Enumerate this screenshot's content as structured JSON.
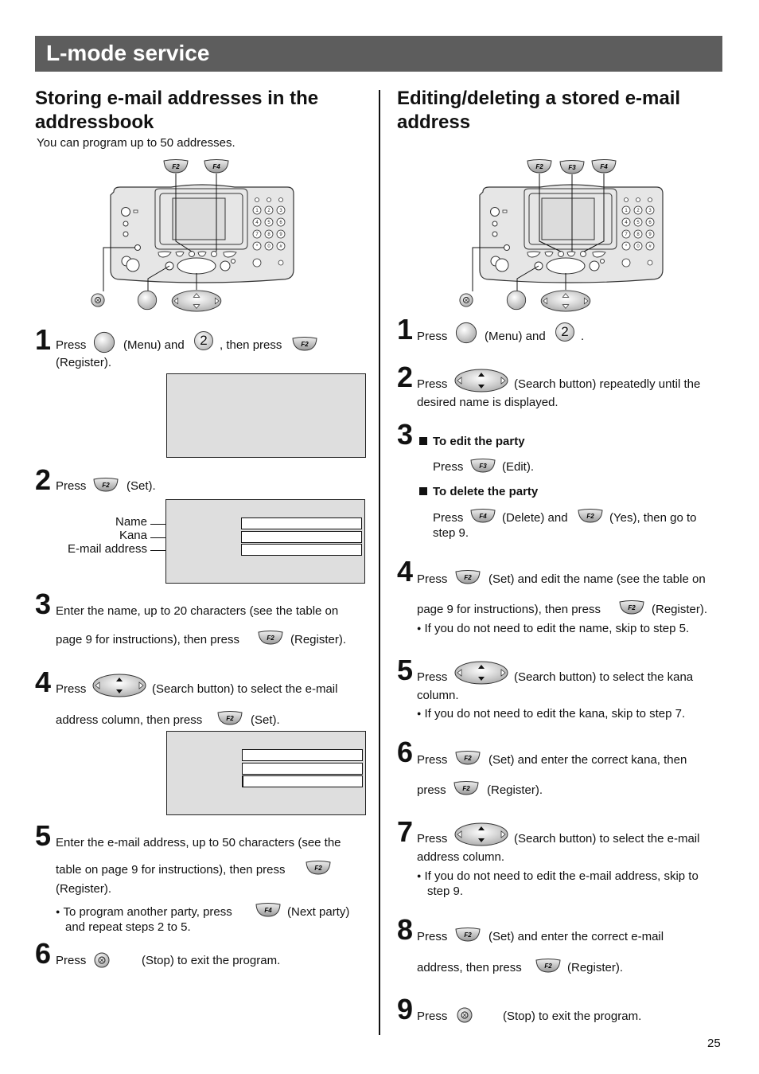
{
  "header": {
    "title": "L-mode service"
  },
  "left": {
    "title_line1": "Storing e-mail addresses in the",
    "title_line2": "addressbook",
    "intro": "You can program up to 50 addresses.",
    "diagram": {
      "softkeys": [
        "F2",
        "F4"
      ]
    },
    "steps": [
      {
        "num": "1",
        "parts": [
          "Press",
          "(Menu) and",
          ", then press",
          "(Register)."
        ],
        "key_2": "2"
      },
      {
        "num": "2",
        "parts": [
          "Press",
          "(Set)."
        ],
        "screen_labels": [
          "Name",
          "Kana",
          "E-mail address"
        ]
      },
      {
        "num": "3",
        "line1": "Enter the name, up to 20 characters (see the table on",
        "line2_a": "page 9 for instructions), then press",
        "line2_b": "(Register)."
      },
      {
        "num": "4",
        "line1_a": "Press",
        "line1_b": "(Search button) to select the e-mail",
        "line2_a": "address column, then press",
        "line2_b": "(Set)."
      },
      {
        "num": "5",
        "line1": "Enter the e-mail address, up to 50 characters (see the",
        "line2_a": "table on page 9 for instructions), then press",
        "line3": "(Register).",
        "bullet_a": "To program another party, press",
        "bullet_b": "(Next party)",
        "bullet_c": "and repeat steps 2 to 5."
      },
      {
        "num": "6",
        "a": "Press",
        "b": "(Stop) to exit the program."
      }
    ]
  },
  "right": {
    "title_line1": "Editing/deleting a stored e-mail",
    "title_line2": "address",
    "diagram": {
      "softkeys": [
        "F2",
        "F3",
        "F4"
      ]
    },
    "steps": [
      {
        "num": "1",
        "a": "Press",
        "b": "(Menu) and",
        "c": ".",
        "key_2": "2"
      },
      {
        "num": "2",
        "a": "Press",
        "b": "(Search button) repeatedly until the",
        "c": "desired name is displayed."
      },
      {
        "num": "3",
        "edit_head": "To edit the party",
        "edit_a": "Press",
        "edit_b": "(Edit).",
        "del_head": "To delete the party",
        "del_a": "Press",
        "del_b": "(Delete) and",
        "del_c": "(Yes), then go to",
        "del_d": "step 9."
      },
      {
        "num": "4",
        "a": "Press",
        "b": "(Set) and edit the name (see the table on",
        "c": "page 9 for instructions), then press",
        "d": "(Register).",
        "bullet": "If you do not need to edit the name, skip to step 5."
      },
      {
        "num": "5",
        "a": "Press",
        "b": "(Search button) to select the kana",
        "c": "column.",
        "bullet": "If you do not need to edit the kana, skip to step 7."
      },
      {
        "num": "6",
        "a": "Press",
        "b": "(Set) and enter the correct kana, then",
        "c": "press",
        "d": "(Register)."
      },
      {
        "num": "7",
        "a": "Press",
        "b": "(Search button) to select the e-mail",
        "c": "address column.",
        "bullet_1": "If you do not need to edit the e-mail address, skip to",
        "bullet_2": "step 9."
      },
      {
        "num": "8",
        "a": "Press",
        "b": "(Set) and enter the correct e-mail",
        "c": "address, then press",
        "d": "(Register)."
      },
      {
        "num": "9",
        "a": "Press",
        "b": "(Stop) to exit the program."
      }
    ]
  },
  "icons": {
    "f2": "F2",
    "f3": "F3",
    "f4": "F4"
  },
  "footer": {
    "page_number": "25"
  }
}
